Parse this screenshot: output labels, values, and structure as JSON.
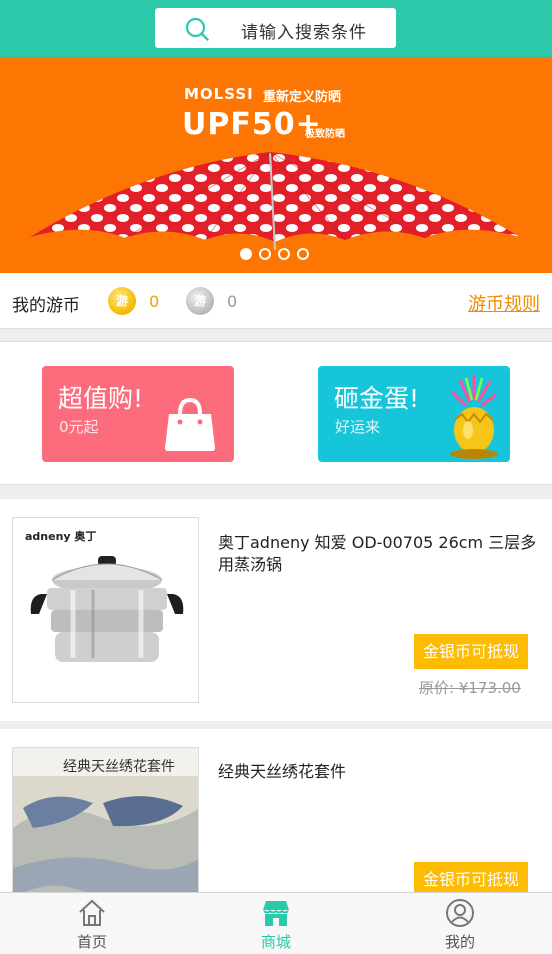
{
  "search": {
    "placeholder": "请输入搜索条件"
  },
  "banner": {
    "brand": "MOLSSI",
    "brand_cn": "重新定义防晒",
    "headline": "UPF50+",
    "sub": "极致防晒",
    "slide_count": 4,
    "active_slide": 1
  },
  "coins": {
    "label": "我的游币",
    "gold_glyph": "游",
    "gold_count": "0",
    "silver_glyph": "游",
    "silver_count": "0",
    "rule_link": "游币规则"
  },
  "promos": [
    {
      "title": "超值购!",
      "sub": "0元起",
      "icon": "shopping-bag-icon"
    },
    {
      "title": "砸金蛋!",
      "sub": "好运来",
      "icon": "golden-egg-icon"
    }
  ],
  "products": [
    {
      "name": "奥丁adneny 知爱 OD-00705 26cm 三层多用蒸汤锅",
      "thumb_brand": "adneny 奥丁",
      "tag": "金银币可抵现",
      "original_price": "原价: ¥173.00"
    },
    {
      "name": "经典天丝绣花套件",
      "thumb_title": "经典天丝绣花套件",
      "tag": "金银币可抵现"
    }
  ],
  "tabs": [
    {
      "label": "首页",
      "icon": "home-icon",
      "active": false
    },
    {
      "label": "商城",
      "icon": "shop-icon",
      "active": true
    },
    {
      "label": "我的",
      "icon": "user-icon",
      "active": false
    }
  ],
  "colors": {
    "accent": "#2bc9a9",
    "banner_bg": "#fd7502",
    "promo_pink": "#fd6c7c",
    "promo_cyan": "#17c5da",
    "tag": "#fdbb02"
  }
}
